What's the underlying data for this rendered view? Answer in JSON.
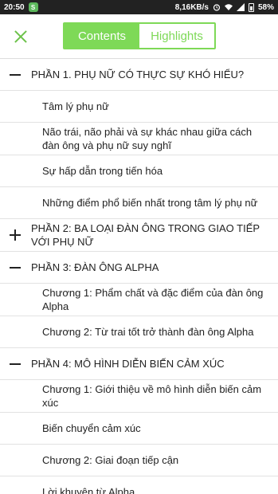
{
  "status_bar": {
    "time": "20:50",
    "app_badge": "S",
    "network_speed": "8,16KB/s",
    "battery": "58%"
  },
  "header": {
    "tabs": [
      {
        "label": "Contents",
        "active": true
      },
      {
        "label": "Highlights",
        "active": false
      }
    ]
  },
  "toc": [
    {
      "type": "section",
      "expanded": true,
      "label": "PHẦN 1. PHỤ NỮ CÓ THỰC SỰ KHÓ HIỂU?"
    },
    {
      "type": "chapter",
      "label": "Tâm lý phụ nữ"
    },
    {
      "type": "chapter",
      "label": "Não trái, não phải và sự khác nhau giữa cách đàn ông và phụ nữ suy nghĩ"
    },
    {
      "type": "chapter",
      "label": "Sự hấp dẫn trong tiến hóa"
    },
    {
      "type": "chapter",
      "label": "Những điểm phổ biến nhất trong tâm lý phụ nữ"
    },
    {
      "type": "section",
      "expanded": false,
      "label": "PHẦN 2: BA LOẠI ĐÀN ÔNG TRONG GIAO TIẾP VỚI PHỤ NỮ"
    },
    {
      "type": "section",
      "expanded": true,
      "label": "PHẦN 3: ĐÀN ÔNG ALPHA"
    },
    {
      "type": "chapter",
      "label": "Chương 1: Phẩm chất và đặc điểm của đàn ông Alpha"
    },
    {
      "type": "chapter",
      "label": "Chương 2: Từ trai tốt trở thành đàn ông Alpha"
    },
    {
      "type": "section",
      "expanded": true,
      "label": "PHẦN 4: MÔ HÌNH DIỄN BIẾN CẢM XÚC"
    },
    {
      "type": "chapter",
      "label": "Chương 1: Giới thiệu về mô hình diễn biến cảm xúc"
    },
    {
      "type": "chapter",
      "label": "Biến chuyển cảm xúc"
    },
    {
      "type": "chapter",
      "label": "Chương 2: Giai đoạn tiếp cận"
    },
    {
      "type": "chapter",
      "label": "Lời khuyên từ Alpha"
    }
  ],
  "colors": {
    "accent": "#7ed957",
    "close_icon": "#6cc24a",
    "divider": "#e2e2e2"
  }
}
